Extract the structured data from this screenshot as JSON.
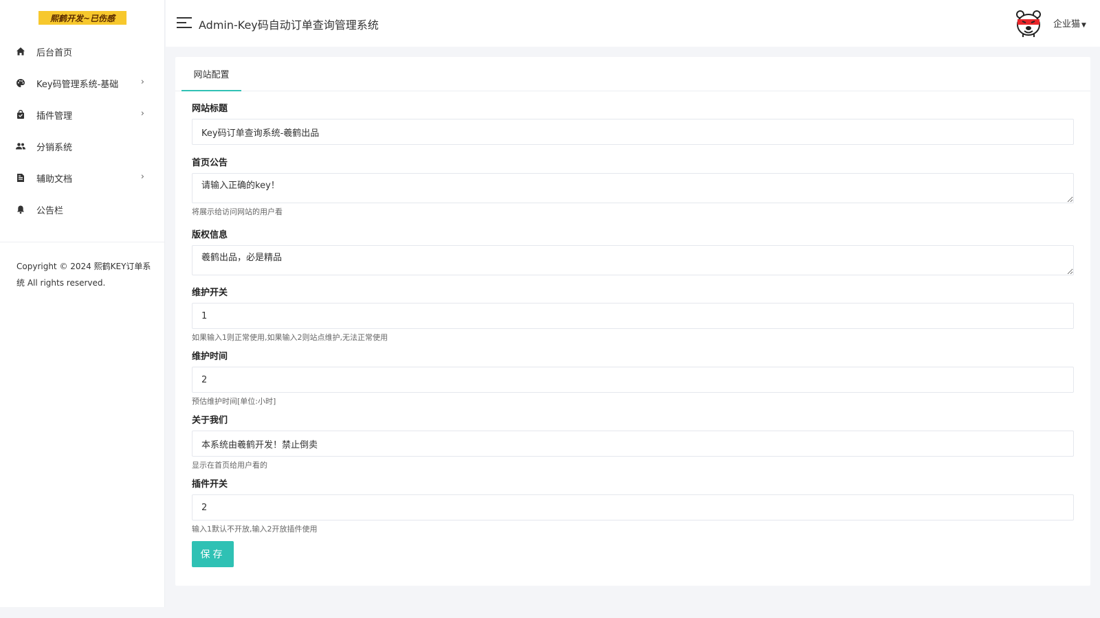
{
  "sidebar": {
    "logo_text": "熙鹤开发~已伤感",
    "items": [
      {
        "label": "后台首页",
        "icon": "home-icon",
        "has_submenu": false
      },
      {
        "label": "Key码管理系统-基础",
        "icon": "palette-icon",
        "has_submenu": true
      },
      {
        "label": "插件管理",
        "icon": "bag-icon",
        "has_submenu": true
      },
      {
        "label": "分销系统",
        "icon": "users-icon",
        "has_submenu": false
      },
      {
        "label": "辅助文档",
        "icon": "document-icon",
        "has_submenu": true
      },
      {
        "label": "公告栏",
        "icon": "bell-icon",
        "has_submenu": false
      }
    ],
    "copyright": "Copyright © 2024 熙鹤KEY订单系统 All rights reserved."
  },
  "header": {
    "title": "Admin-Key码自动订单查询管理系统",
    "user_name": "企业猫"
  },
  "tabs": [
    {
      "label": "网站配置"
    }
  ],
  "form": {
    "site_title": {
      "label": "网站标题",
      "value": "Key码订单查询系统-羲鹤出品"
    },
    "home_notice": {
      "label": "首页公告",
      "value": "请输入正确的key！",
      "help": "将展示给访问网站的用户看"
    },
    "copyright_info": {
      "label": "版权信息",
      "value": "羲鹤出品，必是精品"
    },
    "maintenance_switch": {
      "label": "维护开关",
      "value": "1",
      "help": "如果输入1则正常使用,如果输入2则站点维护,无法正常使用"
    },
    "maintenance_time": {
      "label": "维护时间",
      "value": "2",
      "help": "预估维护时间[单位:小时]"
    },
    "about_us": {
      "label": "关于我们",
      "value": "本系统由羲鹤开发！禁止倒卖",
      "help": "显示在首页给用户看的"
    },
    "plugin_switch": {
      "label": "插件开关",
      "value": "2",
      "help": "输入1默认不开放,输入2开放插件使用"
    },
    "save_label": "保存"
  },
  "colors": {
    "accent": "#2fc1b4",
    "logo_bg": "#f7c82d"
  }
}
